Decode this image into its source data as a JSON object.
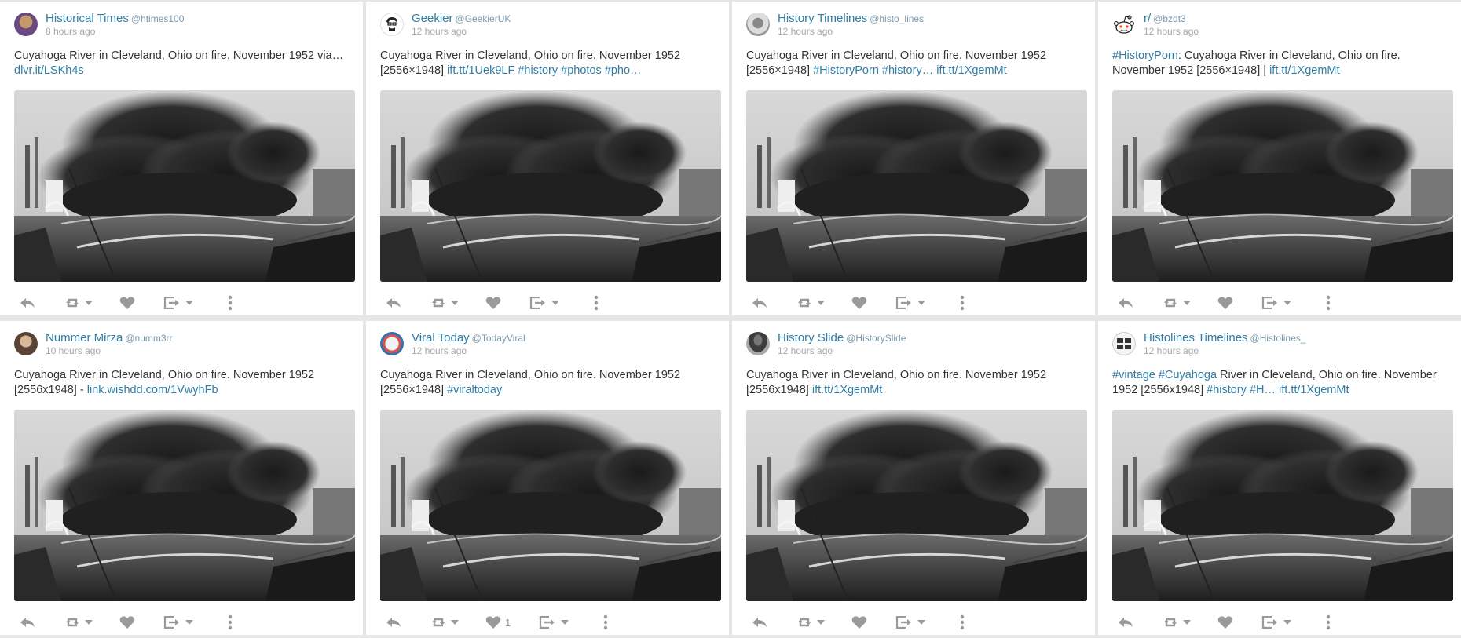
{
  "colors": {
    "link": "#2f7da5",
    "handle": "#7a98aa",
    "time": "#a7a7a7",
    "icon": "#9a9a9a",
    "background": "#e4e6e8"
  },
  "icons": {
    "reply": "reply-icon",
    "retweet": "retweet-icon",
    "like": "heart-icon",
    "share": "share-icon",
    "more": "more-vertical-icon"
  },
  "posts": [
    {
      "name": "Historical Times",
      "handle": "@htimes100",
      "time": "8 hours ago",
      "text": [
        "Cuyahoga River in Cleveland, Ohio on fire. November 1952 via…",
        "dlvr.it/LSKh4s"
      ],
      "likes": "",
      "avatar": "portrait-avatar"
    },
    {
      "name": "Geekier",
      "handle": "@GeekierUK",
      "time": "12 hours ago",
      "text": [
        "Cuyahoga River in Cleveland, Ohio on fire. November 1952",
        "[2556×1948] ",
        "ift.tt/1Uek9LF",
        " ",
        "#history",
        " ",
        "#photos",
        " ",
        "#pho…"
      ],
      "likes": "",
      "avatar": "geek-avatar"
    },
    {
      "name": "History Timelines",
      "handle": "@histo_lines",
      "time": "12 hours ago",
      "text": [
        "Cuyahoga River in Cleveland, Ohio on fire. November 1952",
        "[2556×1948] ",
        "#HistoryPorn",
        " ",
        "#history…",
        " ",
        "ift.tt/1XgemMt"
      ],
      "likes": "",
      "avatar": "timeline-avatar"
    },
    {
      "name": "r/",
      "handle": "@bzdt3",
      "time": "12 hours ago",
      "text": [
        "#HistoryPorn",
        ": Cuyahoga River in Cleveland, Ohio on fire.",
        "November 1952 [2556×1948] | ",
        "ift.tt/1XgemMt"
      ],
      "likes": "",
      "avatar": "reddit-avatar"
    },
    {
      "name": "Nummer Mirza",
      "handle": "@numm3rr",
      "time": "10 hours ago",
      "text": [
        "Cuyahoga River in Cleveland, Ohio on fire. November 1952",
        "[2556x1948] - ",
        "link.wishdd.com/1VwyhFb"
      ],
      "likes": "",
      "avatar": "person-avatar"
    },
    {
      "name": "Viral Today",
      "handle": "@TodayViral",
      "time": "12 hours ago",
      "text": [
        "Cuyahoga River in Cleveland, Ohio on fire. November 1952",
        "[2556×1948] ",
        "#viraltoday"
      ],
      "likes": "1",
      "avatar": "viral-avatar"
    },
    {
      "name": "History Slide",
      "handle": "@HistorySlide",
      "time": "12 hours ago",
      "text": [
        "Cuyahoga River in Cleveland, Ohio on fire. November 1952",
        "[2556x1948] ",
        "ift.tt/1XgemMt"
      ],
      "likes": "",
      "avatar": "statue-avatar"
    },
    {
      "name": "Histolines Timelines",
      "handle": "@Histolines_",
      "time": "12 hours ago",
      "text": [
        "#vintage",
        " ",
        "#Cuyahoga",
        " River in Cleveland, Ohio on fire. November",
        "1952 [2556x1948] ",
        "#history",
        " ",
        "#H…",
        " ",
        "ift.tt/1XgemMt"
      ],
      "likes": "",
      "avatar": "histolines-avatar"
    }
  ]
}
